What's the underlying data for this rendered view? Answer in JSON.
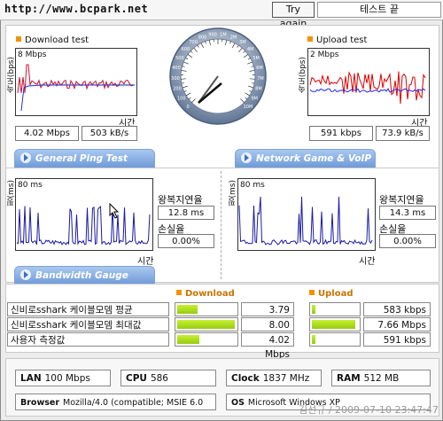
{
  "header": {
    "url": "http://www.bcpark.net",
    "try_again": "Try again",
    "test_status": "테스트 끝"
  },
  "download": {
    "title": "Download test",
    "ylabel": "속도(bps)",
    "yscale": "8 Mbps",
    "xlabel": "시간",
    "mbps": "4.02 Mbps",
    "kbs": "503 kB/s"
  },
  "upload": {
    "title": "Upload test",
    "ylabel": "속도(bps)",
    "yscale": "2 Mbps",
    "xlabel": "시간",
    "kbps": "591 kbps",
    "kbs": "73.9 kB/s"
  },
  "gauge": {
    "ticks": [
      "0",
      "100",
      "200",
      "300",
      "400",
      "500",
      "600",
      "700",
      "800",
      "900",
      "1M",
      "2M",
      "3M",
      "4M",
      "5M",
      "6M",
      "7M",
      "8M",
      "9M",
      "10M"
    ],
    "needle_value": "4.02 Mbps"
  },
  "tabs": {
    "ping": "General Ping Test",
    "game": "Network Game & VoIP Test",
    "bandwidth": "Bandwidth Gauge"
  },
  "ping": {
    "ylabel": "핑(ms)",
    "yscale": "80 ms",
    "xlabel": "시간",
    "rtt_label": "왕복지연율",
    "rtt": "12.8 ms",
    "loss_label": "손실율",
    "loss": "0.00%"
  },
  "game": {
    "ylabel": "핑(ms)",
    "yscale": "80 ms",
    "xlabel": "시간",
    "rtt_label": "왕복지연율",
    "rtt": "14.3 ms",
    "loss_label": "손실율",
    "loss": "0.00%"
  },
  "bandwidth": {
    "download_label": "Download",
    "upload_label": "Upload",
    "rows": [
      {
        "label": "신비로sshark 케이블모뎀 평균",
        "down": "3.79 Mbps",
        "down_frac": 0.35,
        "up": "583 kbps",
        "up_frac": 0.08
      },
      {
        "label": "신비로sshark 케이블모뎀 최대값",
        "down": "8.00 Mbps",
        "down_frac": 0.98,
        "up": "7.66 Mbps",
        "up_frac": 0.95
      },
      {
        "label": "사용자 측정값",
        "down": "4.02 Mbps",
        "down_frac": 0.38,
        "up": "591 kbps",
        "up_frac": 0.08
      }
    ]
  },
  "sysinfo": {
    "lan_label": "LAN",
    "lan": "100 Mbps",
    "cpu_label": "CPU",
    "cpu": "586",
    "clock_label": "Clock",
    "clock": "1837 MHz",
    "ram_label": "RAM",
    "ram": "512 MB",
    "browser_label": "Browser",
    "browser": "Mozilla/4.0 (compatible; MSIE 6.0",
    "os_label": "OS",
    "os": "Microsoft Windows XP",
    "watermark": "김선규 / 2009-07-10 23:47:47"
  },
  "colors": {
    "download_line": "#cc1133",
    "upload_red": "#dd0000",
    "upload_blue": "#2222ee",
    "ping_line": "#1a1aa8",
    "bar_fill": "#b6e21f",
    "tab_blue": "#6f9ad8",
    "orange": "#f39200"
  }
}
